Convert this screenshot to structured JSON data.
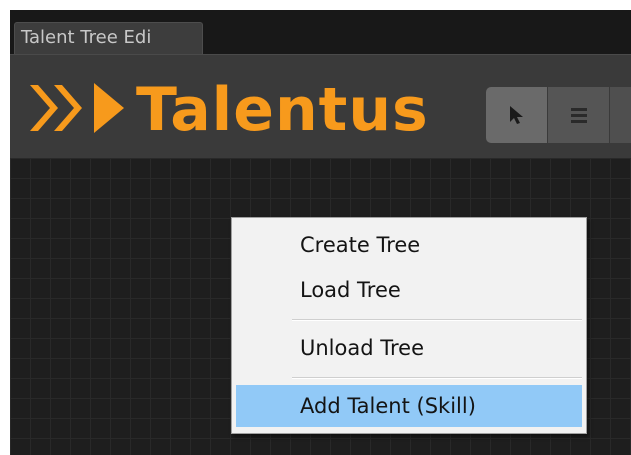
{
  "window": {
    "tab_title": "Talent Tree Edi"
  },
  "header": {
    "logo_text": "Talentus",
    "accent_color": "#f79a1c",
    "toolbar": [
      {
        "icon": "cursor-arrow-icon",
        "active": true
      },
      {
        "icon": "hamburger-menu-icon",
        "active": false
      }
    ]
  },
  "context_menu": {
    "items": [
      {
        "label": "Create Tree"
      },
      {
        "label": "Load Tree"
      },
      {
        "label": "Unload Tree"
      },
      {
        "label": "Add Talent (Skill)",
        "highlighted": true
      }
    ],
    "highlight_color": "#91c9f7"
  }
}
